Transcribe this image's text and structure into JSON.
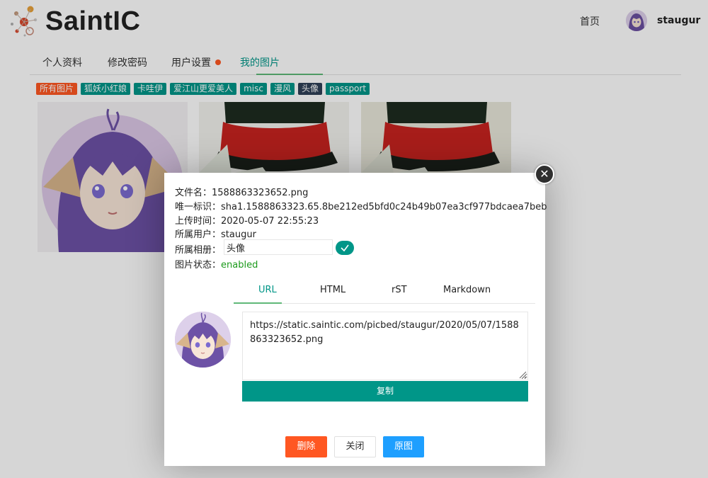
{
  "header": {
    "logo_text": "SaintIC",
    "nav_home": "首页",
    "username": "staugur"
  },
  "tabs": [
    {
      "label": "个人资料"
    },
    {
      "label": "修改密码"
    },
    {
      "label": "用户设置"
    },
    {
      "label": "我的图片"
    }
  ],
  "active_tab": "我的图片",
  "album_tags": [
    {
      "label": "所有图片",
      "color": "#ff5722"
    },
    {
      "label": "狐妖小红娘",
      "color": "#009688"
    },
    {
      "label": "卡哇伊",
      "color": "#009688"
    },
    {
      "label": "爱江山更爱美人",
      "color": "#009688"
    },
    {
      "label": "misc",
      "color": "#009688"
    },
    {
      "label": "漫风",
      "color": "#009688"
    },
    {
      "label": "头像",
      "color": "#2f4056"
    },
    {
      "label": "passport",
      "color": "#009688"
    }
  ],
  "modal": {
    "filename_label": "文件名：",
    "filename": "1588863323652.png",
    "sha_label": "唯一标识：",
    "sha": "sha1.1588863323.65.8be212ed5bfd0c24b49b07ea3cf977bdcaea7beb",
    "upload_time_label": "上传时间：",
    "upload_time": "2020-05-07 22:55:23",
    "owner_label": "所属用户：",
    "owner": "staugur",
    "album_label": "所属相册：",
    "album_value": "头像",
    "status_label": "图片状态：",
    "status": "enabled",
    "link_tabs": [
      {
        "label": "URL"
      },
      {
        "label": "HTML"
      },
      {
        "label": "rST"
      },
      {
        "label": "Markdown"
      }
    ],
    "active_link_tab": "URL",
    "link_text": "https://static.saintic.com/picbed/staugur/2020/05/07/1588863323652.png",
    "copy_label": "复制",
    "buttons": {
      "delete": "删除",
      "close": "关闭",
      "original": "原图"
    }
  },
  "colors": {
    "accent": "#009688",
    "tab_underline": "#5FB878",
    "danger": "#ff5722",
    "primary": "#1E9FFF",
    "status_ok": "#1b9a1b"
  }
}
